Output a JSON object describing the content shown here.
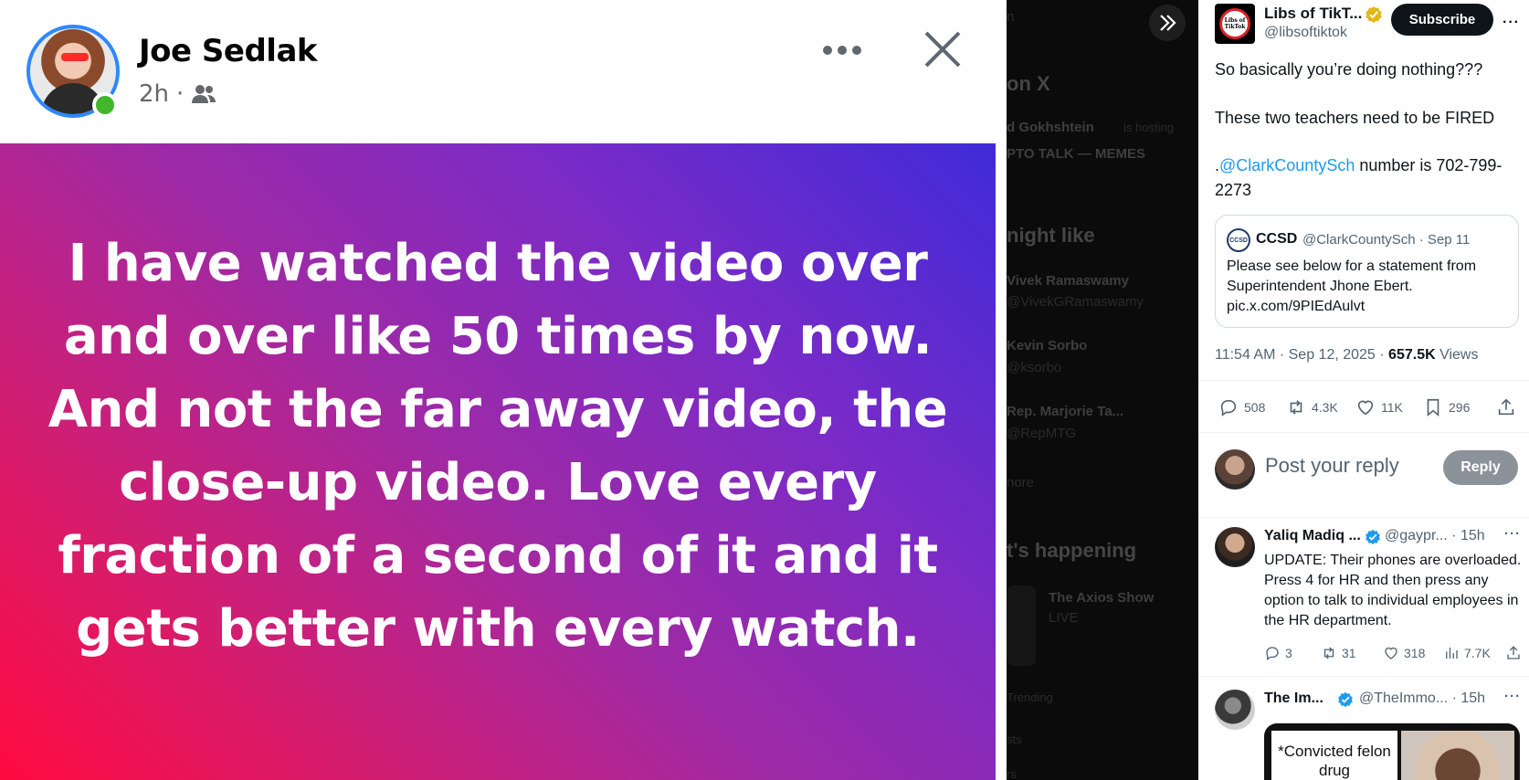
{
  "fb_post": {
    "author": "Joe Sedlak",
    "time": "2h",
    "separator": "·",
    "text": "I have watched the video over and over like 50 times by now. And not the far away video, the close-up video. Love every fraction of a second of it and it gets better with every watch.",
    "colors": {
      "gradient_start": "#3f2bd8",
      "gradient_end": "#ff0a3f",
      "online": "#42b72a"
    }
  },
  "background_x": {
    "top_text": "n",
    "section1": "on X",
    "item1_name": "d Gokhshtein",
    "item1_meta": "is hosting",
    "item1_sub": "PTO TALK — MEMES",
    "section2": "night like",
    "suggest1_name": "Vivek Ramaswamy",
    "suggest1_handle": "@VivekGRamaswamy",
    "suggest2_name": "Kevin Sorbo",
    "suggest2_handle": "@ksorbo",
    "suggest3_name": "Rep. Marjorie Ta...",
    "suggest3_handle": "@RepMTG",
    "show_more": "nore",
    "section3": "t's happening",
    "live_title": "The Axios Show",
    "live_label": "LIVE",
    "trending": "Trending",
    "item_s": "sts",
    "item_last": "rs"
  },
  "tweet": {
    "author_name": "Libs of TikT...",
    "author_handle": "@libsoftiktok",
    "avatar_text": "Libs of TikTok",
    "subscribe_label": "Subscribe",
    "more": "···",
    "line1": "So basically you’re doing nothing???",
    "line2": "These two teachers need to be FIRED",
    "line3_prefix": ".",
    "line3_mention": "@ClarkCountySch",
    "line3_rest": " number is 702-799-2273",
    "quote": {
      "avatar_text": "CCSD",
      "name": "CCSD",
      "handle_date": "@ClarkCountySch · Sep 11",
      "text": "Please see below for a statement from Superintendent Jhone Ebert.",
      "link": "pic.x.com/9PIEdAulvt"
    },
    "timestamp": "11:54 AM · Sep 12, 2025 · ",
    "views_count": "657.5K",
    "views_label": " Views",
    "replies": "508",
    "retweets": "4.3K",
    "likes": "11K",
    "bookmarks": "296",
    "reply_placeholder": "Post your reply",
    "reply_button": "Reply"
  },
  "replies": [
    {
      "name": "Yaliq Madiq ...",
      "handle_time": "@gaypr... · 15h",
      "text": "UPDATE:  Their phones are overloaded.  Press 4 for HR and then press any option to talk to individual employees in the HR department.",
      "replies": "3",
      "retweets": "31",
      "likes": "318",
      "views": "7.7K"
    },
    {
      "name": "The Im...",
      "handle_time": "@TheImmo... · 15h",
      "media_text": "*Convicted felon drug"
    }
  ],
  "colors": {
    "accent": "#1d9bf0",
    "verified_gold": "#e2b719",
    "text_secondary": "#536471"
  }
}
